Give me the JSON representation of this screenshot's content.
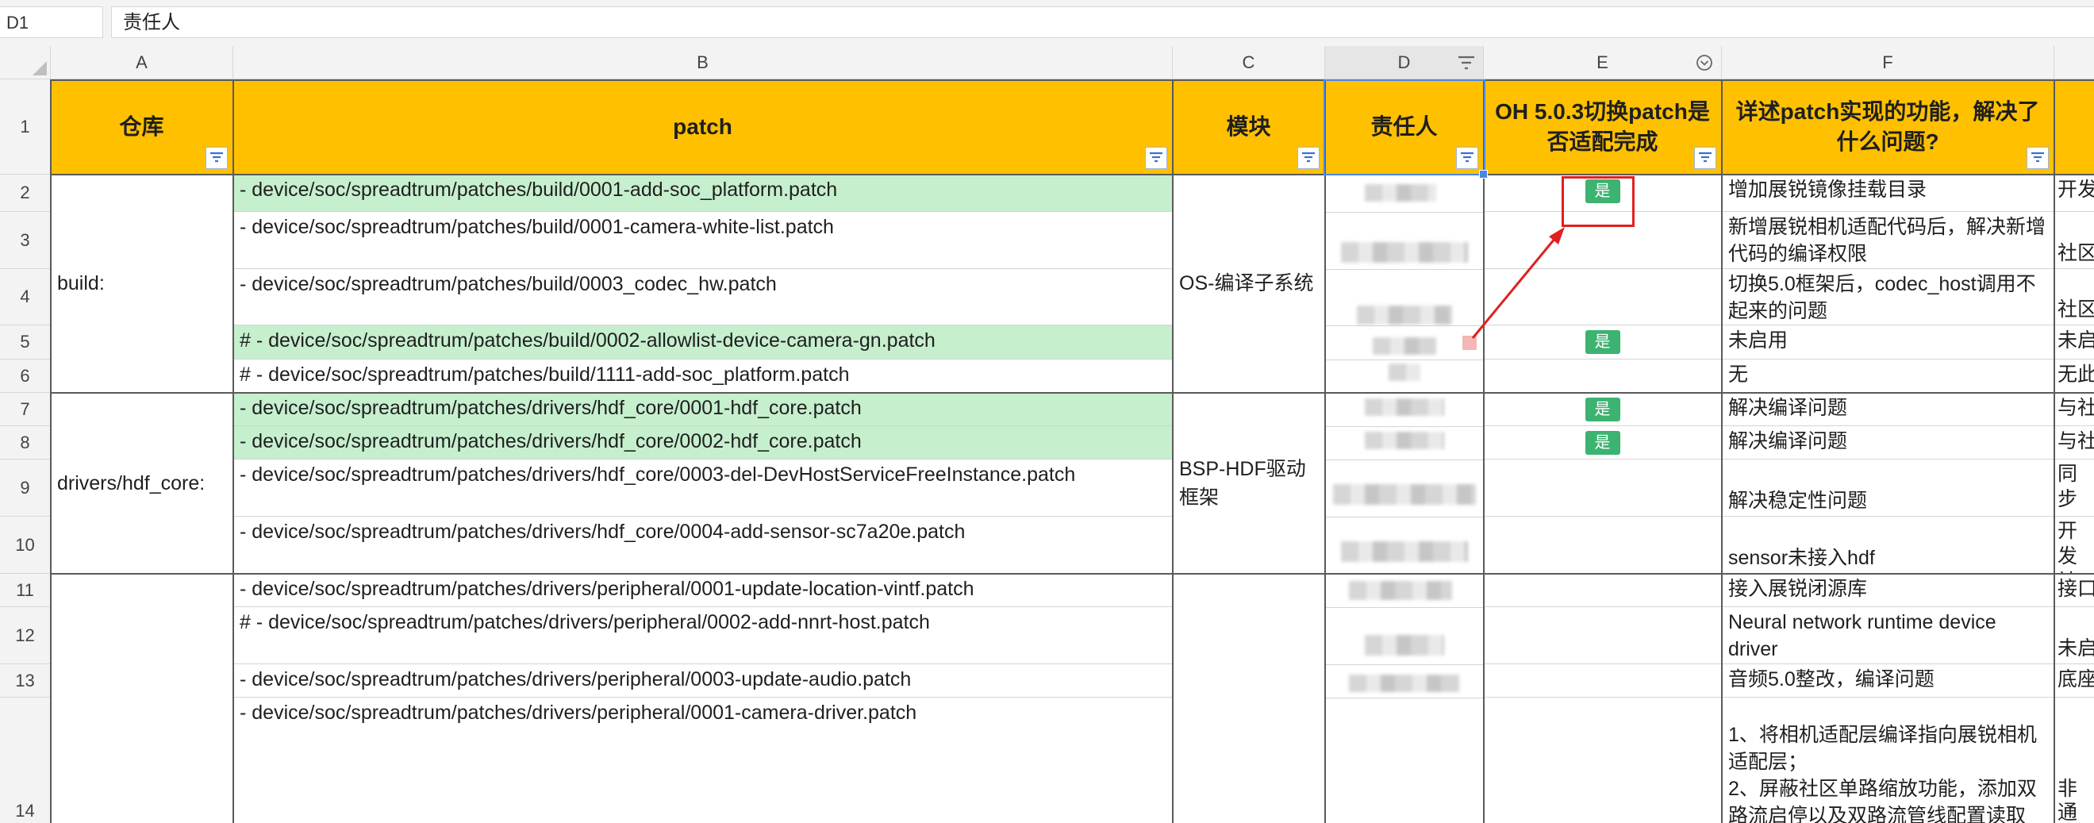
{
  "formula_bar": {
    "cell_ref": "D1",
    "content": "责任人"
  },
  "columns": [
    "A",
    "B",
    "C",
    "D",
    "E",
    "F"
  ],
  "rows": [
    "1",
    "2",
    "3",
    "4",
    "5",
    "6",
    "7",
    "8",
    "9",
    "10",
    "11",
    "12",
    "13",
    "14"
  ],
  "headers": {
    "a": "仓库",
    "b": "patch",
    "c": "模块",
    "d": "责任人",
    "e": "OH 5.0.3切换patch是否适配完成",
    "f": "详述patch实现的功能，解决了什么问题?"
  },
  "repos": {
    "build": "build:",
    "hdf": "drivers/hdf_core:"
  },
  "modules": {
    "compile": "OS-编译子系统",
    "hdf": "BSP-HDF驱动框架"
  },
  "patches": [
    "- device/soc/spreadtrum/patches/build/0001-add-soc_platform.patch",
    "- device/soc/spreadtrum/patches/build/0001-camera-white-list.patch",
    "- device/soc/spreadtrum/patches/build/0003_codec_hw.patch",
    "#   - device/soc/spreadtrum/patches/build/0002-allowlist-device-camera-gn.patch",
    "# - device/soc/spreadtrum/patches/build/1111-add-soc_platform.patch",
    "- device/soc/spreadtrum/patches/drivers/hdf_core/0001-hdf_core.patch",
    "- device/soc/spreadtrum/patches/drivers/hdf_core/0002-hdf_core.patch",
    "- device/soc/spreadtrum/patches/drivers/hdf_core/0003-del-DevHostServiceFreeInstance.patch",
    "- device/soc/spreadtrum/patches/drivers/hdf_core/0004-add-sensor-sc7a20e.patch",
    "- device/soc/spreadtrum/patches/drivers/peripheral/0001-update-location-vintf.patch",
    "# - device/soc/spreadtrum/patches/drivers/peripheral/0002-add-nnrt-host.patch",
    "- device/soc/spreadtrum/patches/drivers/peripheral/0003-update-audio.patch",
    "- device/soc/spreadtrum/patches/drivers/peripheral/0001-camera-driver.patch"
  ],
  "adapted": {
    "yes": "是"
  },
  "descriptions": [
    "增加展锐镜像挂载目录",
    "新增展锐相机适配代码后，解决新增代码的编译权限",
    "切换5.0框架后，codec_host调用不起来的问题",
    "未启用",
    "无",
    "解决编译问题",
    "解决编译问题",
    "解决稳定性问题",
    "sensor未接入hdf",
    "接入展锐闭源库",
    "Neural network runtime device driver",
    "音频5.0整改，编译问题",
    "1、将相机适配层编译指向展锐相机适配层；\n2、屏蔽社区单路缩放功能，添加双路流启停以及双路流管线配置读取"
  ],
  "col_g_partial": [
    "开发",
    "社区",
    "社区",
    "未启",
    "无此",
    "与社",
    "与社",
    "同步",
    "开发\n社区",
    "接口",
    "未启",
    "底座",
    "非通\n码等"
  ],
  "col_g_link": "http",
  "colors": {
    "header_fill": "#ffc000",
    "green_fill": "#c6efce",
    "badge": "#3cb371",
    "annotation": "#e02020",
    "selection": "#4a86e8"
  }
}
